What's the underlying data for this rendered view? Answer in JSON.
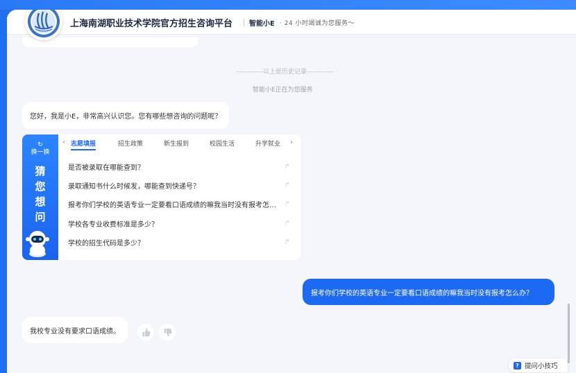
{
  "header": {
    "title": "上海南湖职业技术学院官方招生咨询平台",
    "assistant_name": "智能小E",
    "slogan": "· 24 小时竭诚为您服务～"
  },
  "chat": {
    "history_separator": "------------以上是历史记录------------",
    "status": "智能小E正在为您服务",
    "greeting": "您好，我是小E，非常高兴认识您。您有哪些想咨询的问题呢？",
    "user_message": "报考你们学校的英语专业一定要看口语成绩的嘛我当时没有报考怎么办？",
    "answer": "我校专业没有要求口语成绩。"
  },
  "guess_card": {
    "swap_icon": "↻",
    "swap_label": "换一换",
    "title_chars": [
      "猜",
      "您",
      "想",
      "问"
    ],
    "tabs": [
      "志愿填报",
      "招生政策",
      "新生报到",
      "校园生活",
      "升学就业"
    ],
    "active_tab": 0,
    "questions": [
      "是否被录取在哪能查到？",
      "录取通知书什么时候发，哪能查到快递号？",
      "报考你们学校的英语专业一定要看口语成绩的嘛我当时没有报考怎么办？",
      "学校各专业收费标准是多少？",
      "学校的招生代码是多少？"
    ]
  },
  "tips": {
    "icon": "?",
    "label": "提问小技巧"
  },
  "colors": {
    "brand_blue": "#1d6af2",
    "page_bg": "#f4f6fb"
  },
  "icons": {
    "logo": "school-seal-logo",
    "prev": "chevron-left-icon",
    "next": "chevron-right-icon",
    "question_arrow": "reply-arrow-icon",
    "like": "thumbs-up-icon",
    "dislike": "thumbs-down-icon"
  }
}
